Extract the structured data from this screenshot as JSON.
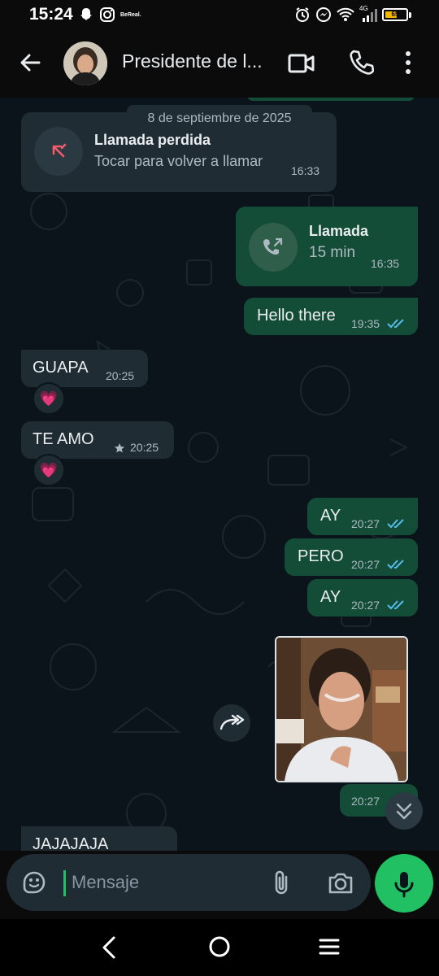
{
  "status_bar": {
    "time": "15:24",
    "bereal": "BeReal.",
    "network": "4G",
    "battery_text": "65",
    "battery_level": 0.65,
    "battery_color": "#f5b800"
  },
  "header": {
    "contact_name": "Presidente de l...",
    "icons": [
      "back-arrow-icon",
      "video-call-icon",
      "phone-icon",
      "more-options-icon"
    ]
  },
  "chat": {
    "date_separator": "8 de septiembre de 2025",
    "missed_call": {
      "title": "Llamada perdida",
      "subtitle": "Tocar para volver a llamar",
      "time": "16:33"
    },
    "call": {
      "title": "Llamada",
      "duration": "15 min",
      "time": "16:35"
    },
    "messages": [
      {
        "text": "Hello there",
        "time": "19:35",
        "dir": "out"
      },
      {
        "text": "GUAPA",
        "time": "20:25",
        "dir": "in",
        "reaction": "💗"
      },
      {
        "text": "TE AMO",
        "time": "20:25",
        "dir": "in",
        "starred": true,
        "reaction": "💗"
      },
      {
        "text": "AY",
        "time": "20:27",
        "dir": "out"
      },
      {
        "text": "PERO",
        "time": "20:27",
        "dir": "out"
      },
      {
        "text": "AY",
        "time": "20:27",
        "dir": "out"
      },
      {
        "text": "",
        "time": "20:27",
        "dir": "out",
        "image": true
      },
      {
        "text": "JAJAJAJA",
        "time": "",
        "dir": "in"
      }
    ],
    "colors": {
      "incoming": "#1f2c34",
      "outgoing": "#144d37",
      "read_ticks": "#53bdeb",
      "accent": "#21c063"
    }
  },
  "input": {
    "placeholder": "Mensaje",
    "icons": [
      "sticker-icon",
      "attach-icon",
      "camera-icon",
      "mic-icon"
    ]
  },
  "navbar": {
    "icons": [
      "nav-back-icon",
      "nav-home-icon",
      "nav-menu-icon"
    ]
  }
}
